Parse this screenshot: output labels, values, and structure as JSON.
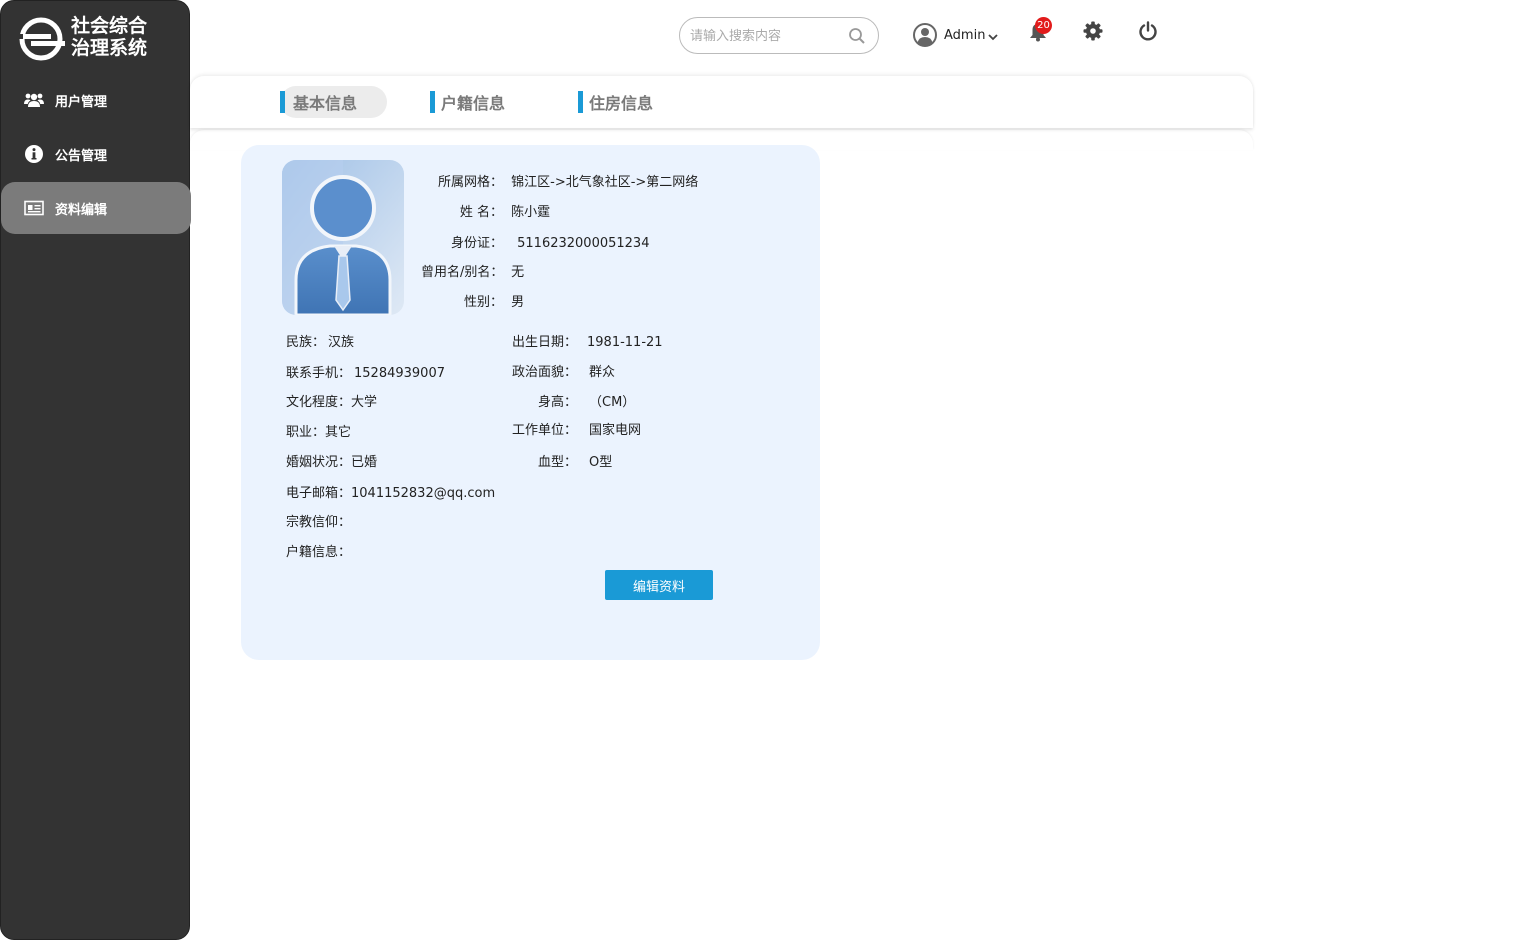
{
  "app": {
    "logo_line1": "社会综合",
    "logo_line2": "治理系统"
  },
  "sidebar": {
    "items": [
      {
        "label": "用户管理",
        "icon": "users-icon"
      },
      {
        "label": "公告管理",
        "icon": "info-icon"
      },
      {
        "label": "资料编辑",
        "icon": "id-card-icon",
        "active": true
      }
    ]
  },
  "header": {
    "search_placeholder": "请输入搜索内容",
    "user_name": "Admin",
    "notification_count": "20"
  },
  "tabs": [
    {
      "label": "基本信息",
      "active": true
    },
    {
      "label": "户籍信息"
    },
    {
      "label": "住房信息"
    }
  ],
  "profile": {
    "top": [
      {
        "label": "所属网格：",
        "value": "锦江区->北气象社区->第二网络"
      },
      {
        "label": "姓 名：",
        "value": "陈小霆"
      },
      {
        "label": "身份证：",
        "value": "5116232000051234"
      },
      {
        "label": "曾用名/别名：",
        "value": "无"
      },
      {
        "label": "性别：",
        "value": "男"
      }
    ],
    "left": [
      {
        "label": "民族：",
        "value": "汉族"
      },
      {
        "label": "联系手机：",
        "value": "15284939007"
      },
      {
        "label": "文化程度：",
        "value": "大学"
      },
      {
        "label": "职业：",
        "value": "其它"
      },
      {
        "label": "婚姻状况：",
        "value": "已婚"
      },
      {
        "label": "电子邮箱：",
        "value": "1041152832@qq.com"
      },
      {
        "label": "宗教信仰：",
        "value": ""
      },
      {
        "label": "户籍信息：",
        "value": ""
      }
    ],
    "right": [
      {
        "label": "出生日期：",
        "value": "1981-11-21"
      },
      {
        "label": "政治面貌：",
        "value": "群众"
      },
      {
        "label": "身高：",
        "value": "（CM）"
      },
      {
        "label": "工作单位：",
        "value": "国家电网"
      },
      {
        "label": "血型：",
        "value": "O型"
      }
    ],
    "edit_button": "编辑资料"
  },
  "colors": {
    "sidebar_bg": "#333333",
    "accent": "#1a9ad6",
    "card_bg": "#ebf3fe",
    "badge": "#e21b1b"
  }
}
